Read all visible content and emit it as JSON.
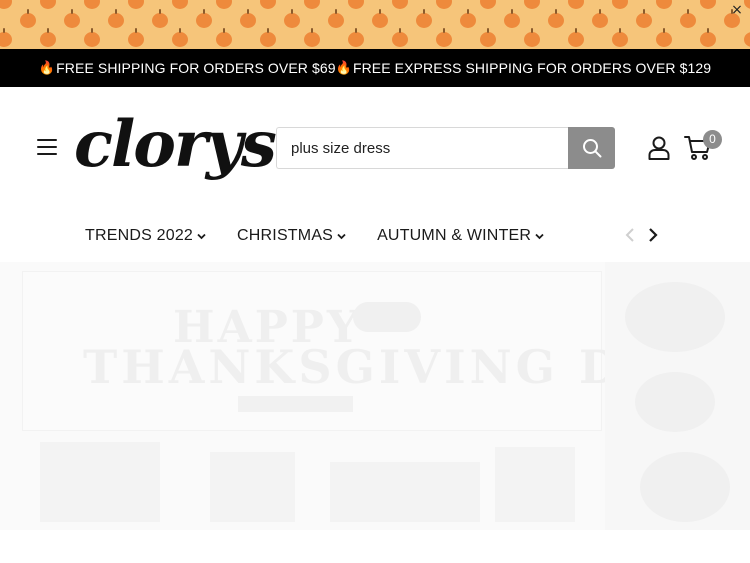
{
  "promo_strip": {
    "close_label": "×",
    "colors": {
      "background": "#f6c57a",
      "pattern": "#ee8a3c"
    },
    "pattern_icon": "pumpkin-icon"
  },
  "announcement": {
    "segments": [
      {
        "icon": "🔥",
        "text": "FREE SHIPPING FOR ORDERS OVER $69 "
      },
      {
        "icon": "🔥",
        "text": "FREE EXPRESS SHIPPING FOR ORDERS OVER $129"
      }
    ]
  },
  "header": {
    "logo_text": "clorys",
    "search": {
      "value": "plus size dress",
      "button_icon": "search-icon"
    },
    "account_icon": "user-icon",
    "cart": {
      "icon": "cart-icon",
      "count": "0"
    }
  },
  "nav": {
    "items": [
      {
        "label": "TRENDS 2022",
        "icon": "chevron-down-icon"
      },
      {
        "label": "CHRISTMAS",
        "icon": "chevron-down-icon"
      },
      {
        "label": "AUTUMN & WINTER",
        "icon": "chevron-down-icon"
      }
    ],
    "prev_icon": "chevron-left-icon",
    "next_icon": "chevron-right-icon"
  },
  "hero": {
    "line1": "HAPPY",
    "line2": "THANKSGIVING DAY"
  },
  "colors": {
    "announcement_bg": "#000000",
    "search_button": "#8c8c8c",
    "badge": "#8c8c8c"
  }
}
